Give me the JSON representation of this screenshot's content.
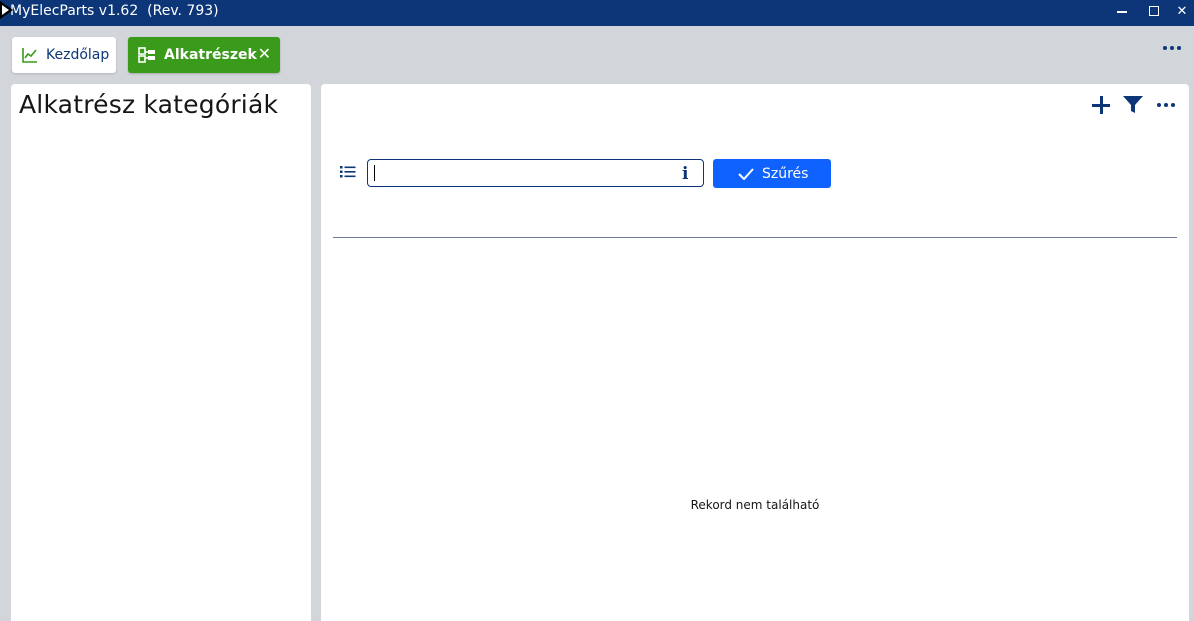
{
  "window": {
    "title": "MyElecParts v1.62  (Rev. 793)",
    "controls": {
      "minimize": "",
      "maximize": "",
      "close": "✕"
    }
  },
  "tabs": [
    {
      "label": "Kezdőlap",
      "icon": "chart-line-icon",
      "active": false
    },
    {
      "label": "Alkatrészek",
      "icon": "parts-tree-icon",
      "active": true,
      "close": "✕"
    }
  ],
  "left_panel": {
    "title": "Alkatrész kategóriák"
  },
  "right_panel": {
    "actions": [
      "add-icon",
      "filter-icon",
      "more-icon"
    ],
    "search": {
      "value": "",
      "placeholder": "",
      "info": "i"
    },
    "filter_button": {
      "label": "Szűrés",
      "icon": "checkmark-icon"
    },
    "empty_message": "Rekord nem található"
  },
  "colors": {
    "titlebar": "#0c3677",
    "accent": "#0f62fe",
    "active_tab": "#3a9a19",
    "background": "#d2d5da"
  }
}
